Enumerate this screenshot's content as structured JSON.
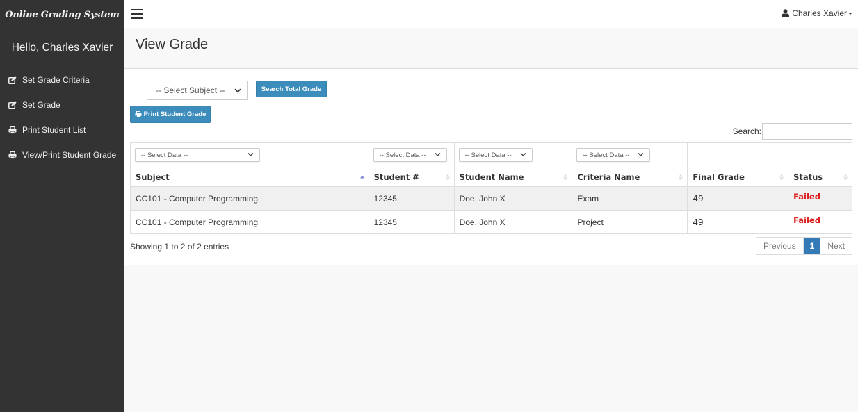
{
  "app": {
    "brand": "Online Grading System",
    "greeting": "Hello, Charles Xavier"
  },
  "sidebar": {
    "items": [
      {
        "label": "Set Grade Criteria",
        "icon": "edit-icon"
      },
      {
        "label": "Set Grade",
        "icon": "edit-icon"
      },
      {
        "label": "Print Student List",
        "icon": "print-icon"
      },
      {
        "label": "View/Print Student Grade",
        "icon": "print-icon"
      }
    ]
  },
  "topbar": {
    "menu_icon": "hamburger-icon",
    "user_name": "Charles Xavier",
    "user_icon": "user-icon"
  },
  "page": {
    "title": "View Grade"
  },
  "controls": {
    "subject_select": "-- Select Subject --",
    "search_total_label": "Search Total Grade",
    "print_grade_label": "Print Student Grade",
    "search_label": "Search:",
    "search_value": ""
  },
  "table": {
    "filters": [
      "-- Select Data --",
      "-- Select Data --",
      "-- Select Data --",
      "-- Select Data --"
    ],
    "columns": [
      "Subject",
      "Student #",
      "Student Name",
      "Criteria Name",
      "Final Grade",
      "Status"
    ],
    "sorted_column": "Subject",
    "sort_direction": "asc",
    "rows": [
      {
        "subject": "CC101 - Computer Programming",
        "student_no": "12345",
        "student_name": "Doe, John X",
        "criteria": "Exam",
        "final_grade": "49",
        "status": "Failed"
      },
      {
        "subject": "CC101 - Computer Programming",
        "student_no": "12345",
        "student_name": "Doe, John X",
        "criteria": "Project",
        "final_grade": "49",
        "status": "Failed"
      }
    ]
  },
  "footer": {
    "info": "Showing 1 to 2 of 2 entries",
    "pagination": {
      "previous": "Previous",
      "current": "1",
      "next": "Next"
    }
  },
  "colors": {
    "sidebar_bg": "#333333",
    "primary_button": "#3c8dbc",
    "active_page": "#337ab7",
    "status_failed": "#dd2020"
  }
}
